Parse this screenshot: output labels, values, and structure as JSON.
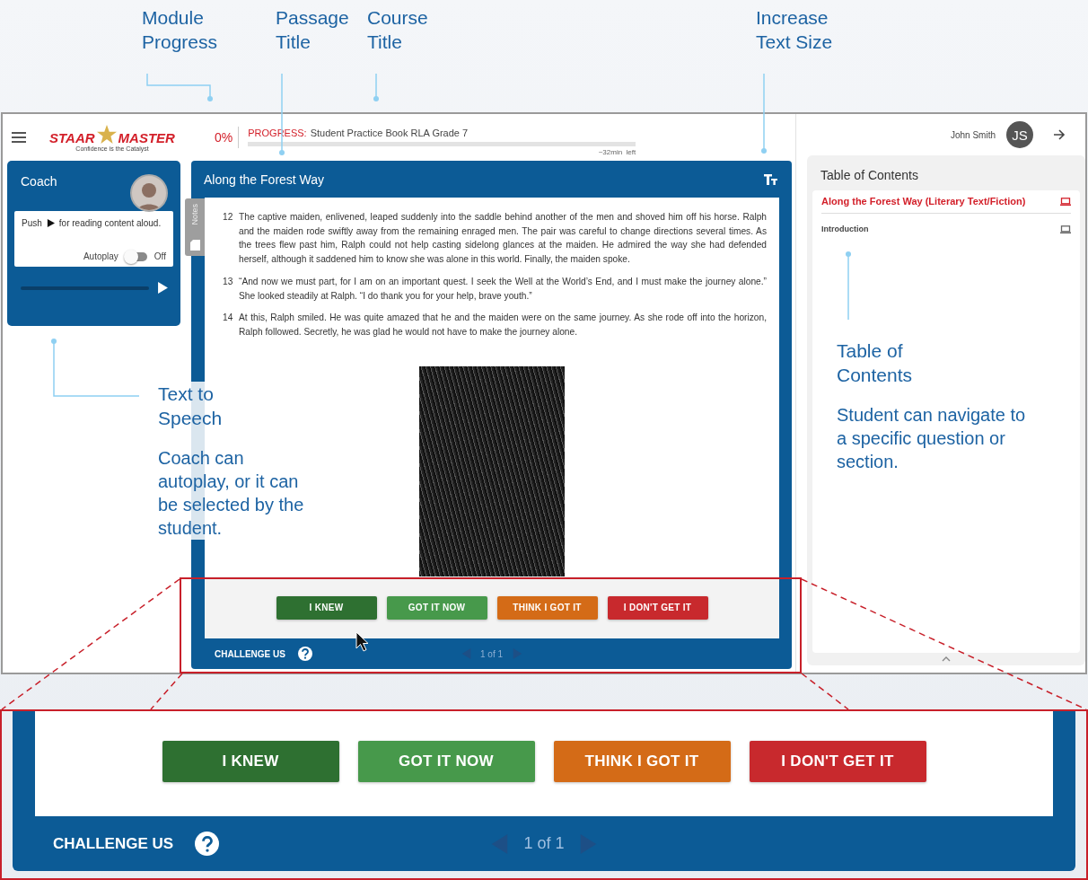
{
  "callouts": [
    {
      "title": "Module Progress"
    },
    {
      "title": "Passage Title"
    },
    {
      "title": "Course Title"
    },
    {
      "title": "Increase Text Size"
    },
    {
      "title": "Text to Speech",
      "description": "Coach can autoplay, or it can be selected by the student."
    },
    {
      "title": "Table of Contents",
      "description": "Student can navigate to a specific question or section."
    }
  ],
  "header": {
    "logo_top": "STAAR",
    "logo_bottom": "MASTER",
    "tagline": "Confidence is the Catalyst",
    "percent": "0%",
    "progress_label": "PROGRESS:",
    "course": "Student Practice Book RLA Grade 7",
    "level": 0,
    "time_left": "~32min  left"
  },
  "user": {
    "name": "John Smith",
    "initials": "JS"
  },
  "coach": {
    "title": "Coach",
    "message_before": "Push",
    "message_after": "for reading content aloud.",
    "autoplay_label": "Autoplay",
    "autoplay_on": false,
    "autoplay_state": "Off",
    "level": 0
  },
  "passage": {
    "title": "Along the Forest Way",
    "notes_label": "Notes",
    "paragraphs": [
      {
        "number": "12",
        "text": "The captive maiden, enlivened, leaped suddenly into the saddle behind another of the men and shoved him off his horse. Ralph and the maiden rode swiftly away from the remaining enraged men. The pair was careful to change directions several times. As the trees flew past him, Ralph could not help casting sidelong glances at the maiden. He admired the way she had defended herself, although it saddened him to know she was alone in this world. Finally, the maiden spoke."
      },
      {
        "number": "13",
        "text": "“And now we must part, for I am on an important quest. I seek the Well at the World’s End, and I must make the journey alone.” She looked steadily at Ralph. “I do thank you for your help, brave youth.”"
      },
      {
        "number": "14",
        "text": "At this, Ralph smiled. He was quite amazed that he and the maiden were on the same journey. As she rode off into the horizon, Ralph followed. Secretly, he was glad he would not have to make the journey alone."
      }
    ],
    "buttons": [
      {
        "label": "I KNEW",
        "color": "#2e7031"
      },
      {
        "label": "GOT IT NOW",
        "color": "#47994b"
      },
      {
        "label": "THINK I GOT IT",
        "color": "#d46b17"
      },
      {
        "label": "I DON'T GET IT",
        "color": "#c8292d"
      }
    ],
    "challenge": "CHALLENGE US",
    "page": "1 of 1"
  },
  "toc": {
    "title": "Table of Contents",
    "items": [
      {
        "label": "Along the Forest Way (Literary Text/Fiction)",
        "selected": true
      },
      {
        "label": "Introduction",
        "selected": false
      }
    ]
  },
  "inset": {
    "buttons": [
      {
        "label": "I KNEW",
        "color": "#2e7031"
      },
      {
        "label": "GOT IT NOW",
        "color": "#47994b"
      },
      {
        "label": "THINK I GOT IT",
        "color": "#d46b17"
      },
      {
        "label": "I DON'T GET IT",
        "color": "#c8292d"
      }
    ],
    "challenge": "CHALLENGE US",
    "page": "1 of 1"
  }
}
